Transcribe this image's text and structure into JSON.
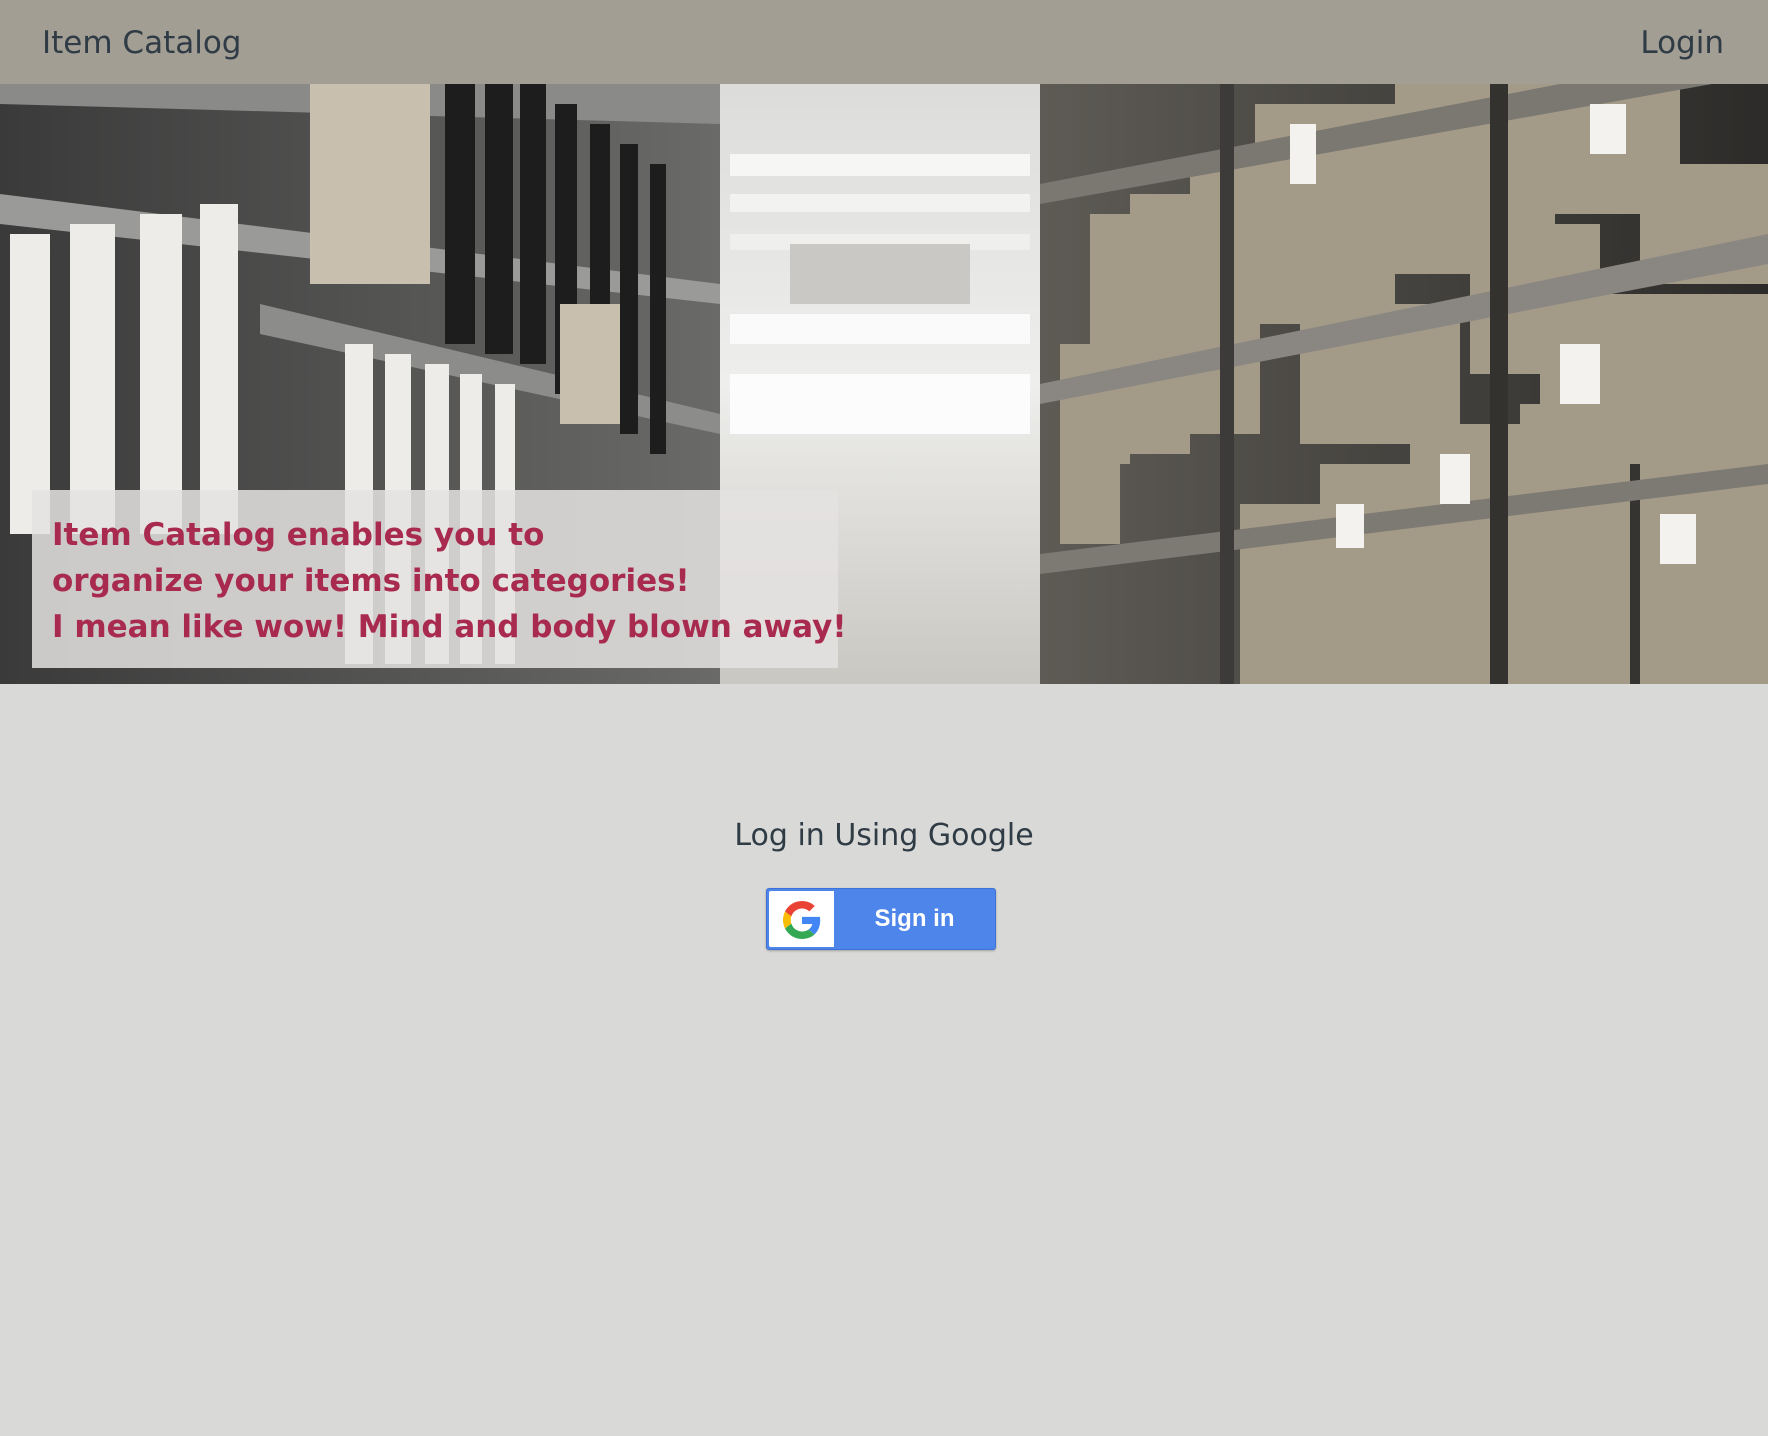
{
  "navbar": {
    "brand": "Item Catalog",
    "login_link": "Login",
    "background_color": "#a29e94"
  },
  "hero": {
    "image": "warehouse-shelves-with-boxes-and-binders",
    "caption_lines": [
      "Item Catalog enables you to",
      "organize your items into categories!",
      "I mean like wow! Mind and body blown away!"
    ],
    "caption_color": "#a82a4f"
  },
  "login": {
    "heading": "Log in Using Google",
    "google_button_label": "Sign in",
    "google_button_color": "#4d85ea",
    "icon": "google-g-icon"
  },
  "page": {
    "background_color": "#d9d9d7"
  }
}
